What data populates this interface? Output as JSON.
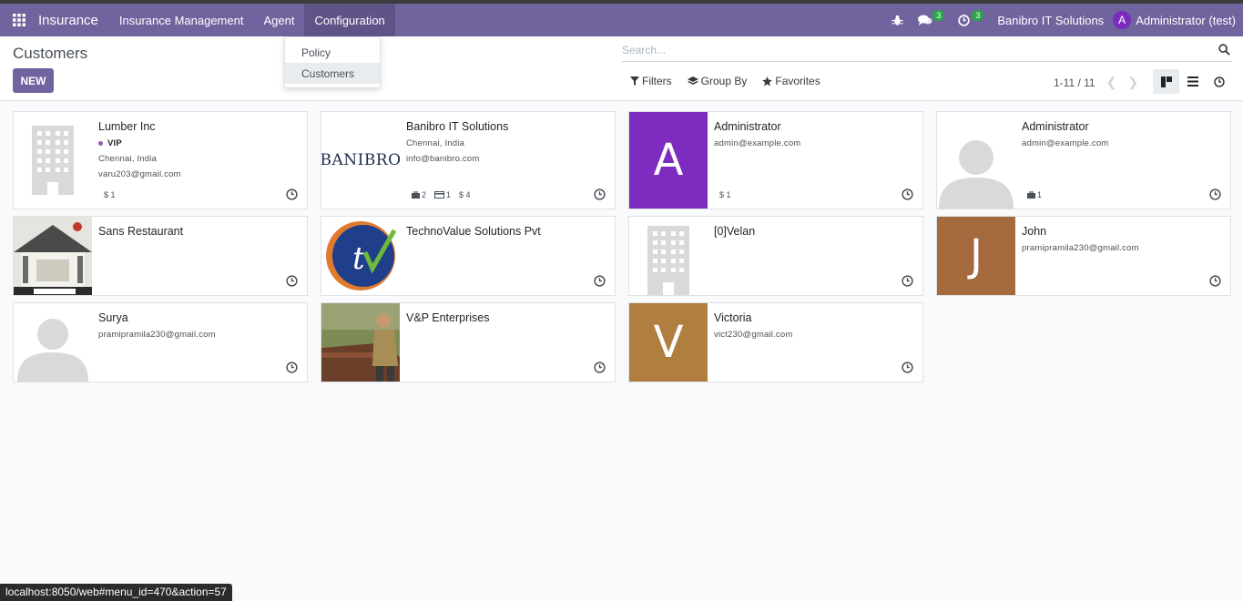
{
  "navbar": {
    "app_name": "Insurance",
    "menus": [
      "Insurance Management",
      "Agent",
      "Configuration"
    ],
    "chat_count": "3",
    "activity_count": "3",
    "company": "Banibro IT Solutions",
    "user_initial": "A",
    "user_name": "Administrator (test)",
    "color": "#71639e"
  },
  "config_dropdown": {
    "items": [
      "Policy",
      "Customers"
    ]
  },
  "control_panel": {
    "breadcrumb": "Customers",
    "new_label": "NEW",
    "search_placeholder": "Search...",
    "filters_label": "Filters",
    "group_by_label": "Group By",
    "favorites_label": "Favorites",
    "pager": "1-11 / 11"
  },
  "cards": [
    {
      "name": "Lumber Inc",
      "tag": "VIP",
      "lines": [
        "Chennai, India",
        "varu203@gmail.com"
      ],
      "stats": [
        "$ 1"
      ],
      "image": "company-placeholder"
    },
    {
      "name": "Banibro IT Solutions",
      "lines": [
        "Chennai, India",
        "info@banibro.com"
      ],
      "stats": [
        "2",
        "1",
        "$ 4"
      ],
      "image": "banibro-logo",
      "logo_text": "BANIBRO"
    },
    {
      "name": "Administrator",
      "lines": [
        "admin@example.com"
      ],
      "stats": [
        "$ 1"
      ],
      "image": "letter-avatar",
      "letter": "A",
      "color": "#7e2cbf"
    },
    {
      "name": "Administrator",
      "lines": [
        "admin@example.com"
      ],
      "stats": [
        "1"
      ],
      "image": "person-placeholder"
    },
    {
      "name": "Sans Restaurant",
      "lines": [],
      "stats": [],
      "image": "restaurant-photo"
    },
    {
      "name": "TechnoValue Solutions Pvt",
      "lines": [],
      "stats": [],
      "image": "technovalue-logo"
    },
    {
      "name": "[0]Velan",
      "lines": [],
      "stats": [],
      "image": "company-placeholder"
    },
    {
      "name": "John",
      "lines": [
        "pramipramila230@gmail.com"
      ],
      "stats": [],
      "image": "letter-avatar",
      "letter": "J",
      "color": "#a46a3e"
    },
    {
      "name": "Surya",
      "lines": [
        "pramipramila230@gmail.com"
      ],
      "stats": [],
      "image": "person-placeholder"
    },
    {
      "name": "V&P Enterprises",
      "lines": [],
      "stats": [],
      "image": "worker-photo"
    },
    {
      "name": "Victoria",
      "lines": [
        "vict230@gmail.com"
      ],
      "stats": [],
      "image": "letter-avatar",
      "letter": "V",
      "color": "#b07e3e"
    }
  ],
  "status_url": "localhost:8050/web#menu_id=470&action=57"
}
